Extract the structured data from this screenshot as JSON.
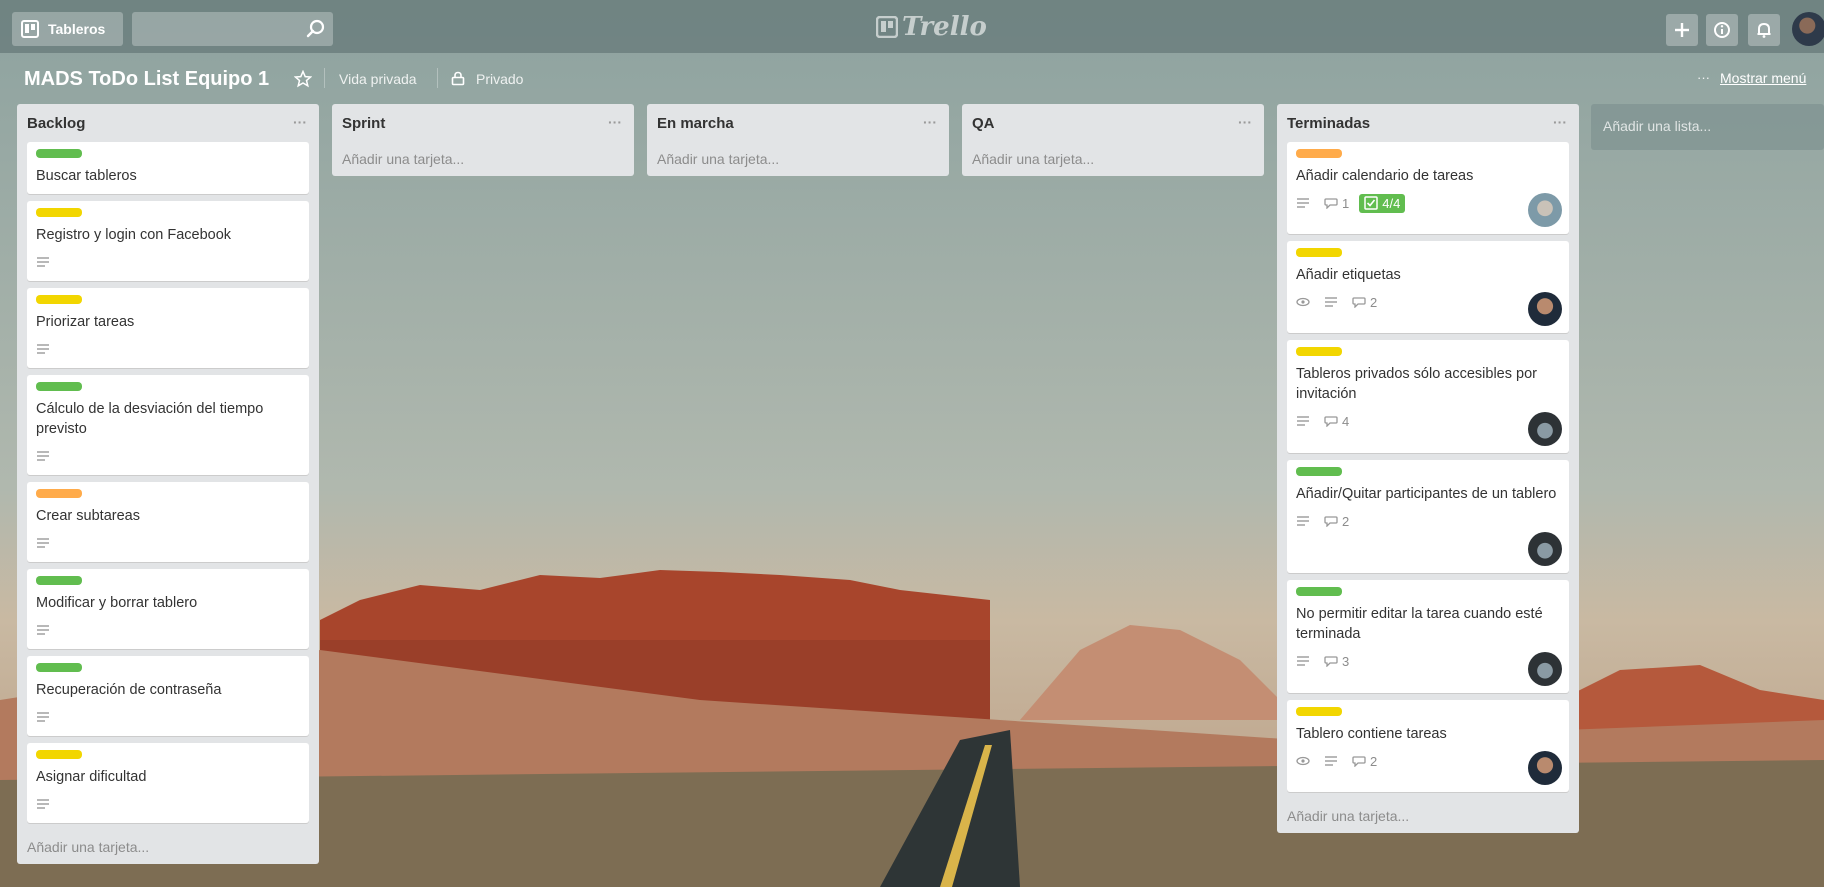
{
  "header": {
    "boards_label": "Tableros",
    "search_placeholder": "",
    "logo_text": "Trello"
  },
  "board": {
    "title": "MADS ToDo List Equipo 1",
    "visibility_team": "Vida privada",
    "visibility_privacy": "Privado",
    "menu_dots": "···",
    "show_menu": "Mostrar menú"
  },
  "colors": {
    "green": "#61bd4f",
    "yellow": "#f2d600",
    "orange": "#ffab4a"
  },
  "lists": [
    {
      "title": "Backlog",
      "dots": "···",
      "add_card": "Añadir una tarjeta...",
      "cards": [
        {
          "label": "green",
          "title": "Buscar tableros",
          "badges": []
        },
        {
          "label": "yellow",
          "title": "Registro y login con Facebook",
          "badges": [
            "description-icon"
          ]
        },
        {
          "label": "yellow",
          "title": "Priorizar tareas",
          "badges": [
            "description-icon"
          ]
        },
        {
          "label": "green",
          "title": "Cálculo de la desviación del tiempo previsto",
          "badges": [
            "description-icon"
          ]
        },
        {
          "label": "orange",
          "title": "Crear subtareas",
          "badges": [
            "description-icon"
          ]
        },
        {
          "label": "green",
          "title": "Modificar y borrar tablero",
          "badges": [
            "description-icon"
          ]
        },
        {
          "label": "green",
          "title": "Recuperación de contraseña",
          "badges": [
            "description-icon"
          ]
        },
        {
          "label": "yellow",
          "title": "Asignar dificultad",
          "badges": [
            "description-icon"
          ]
        }
      ]
    },
    {
      "title": "Sprint",
      "dots": "···",
      "add_card": "Añadir una tarjeta...",
      "cards": []
    },
    {
      "title": "En marcha",
      "dots": "···",
      "add_card": "Añadir una tarjeta...",
      "cards": []
    },
    {
      "title": "QA",
      "dots": "···",
      "add_card": "Añadir una tarjeta...",
      "cards": []
    },
    {
      "title": "Terminadas",
      "dots": "···",
      "add_card": "Añadir una tarjeta...",
      "cards": [
        {
          "label": "orange",
          "title": "Añadir calendario de tareas",
          "comments": "1",
          "checklist": "4/4",
          "avatar": "light"
        },
        {
          "label": "yellow",
          "title": "Añadir etiquetas",
          "comments": "2",
          "watch": true,
          "avatar": "face"
        },
        {
          "label": "yellow",
          "title": "Tableros privados sólo accesibles por invitación",
          "comments": "4",
          "avatar": "dark"
        },
        {
          "label": "green",
          "title": "Añadir/Quitar participantes de un tablero",
          "comments": "2",
          "avatar": "dark"
        },
        {
          "label": "green",
          "title": "No permitir editar la tarea cuando esté terminada",
          "comments": "3",
          "avatar": "dark"
        },
        {
          "label": "yellow",
          "title": "Tablero contiene tareas",
          "comments": "2",
          "watch": true,
          "avatar": "face"
        }
      ]
    }
  ],
  "add_list": "Añadir una lista..."
}
